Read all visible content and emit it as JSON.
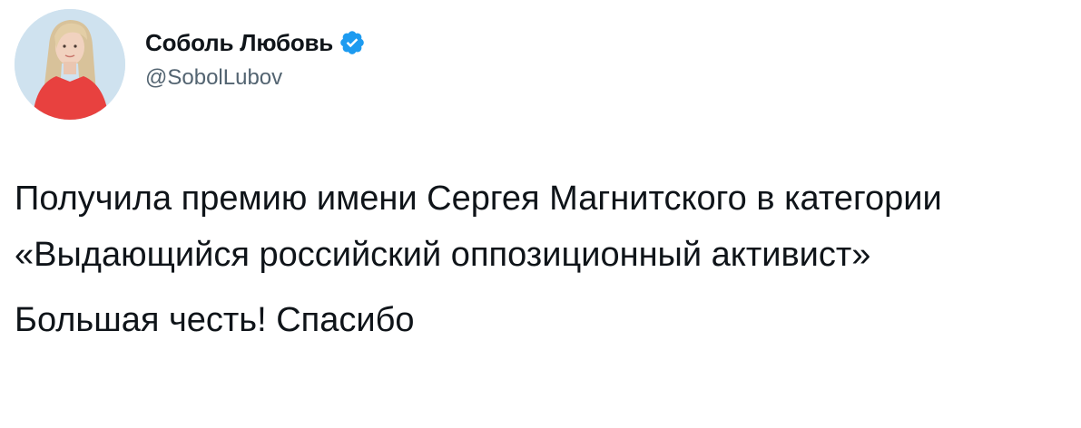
{
  "author": {
    "display_name": "Соболь Любовь",
    "handle": "@SobolLubov",
    "verified": true,
    "verified_color": "#1d9bf0",
    "avatar_icon": "profile-photo"
  },
  "tweet": {
    "paragraph_1": "Получила премию имени Сергея Магнитского в категории «Выдающийся российский оппозиционный активист»",
    "paragraph_2": "Большая честь! Спасибо"
  }
}
